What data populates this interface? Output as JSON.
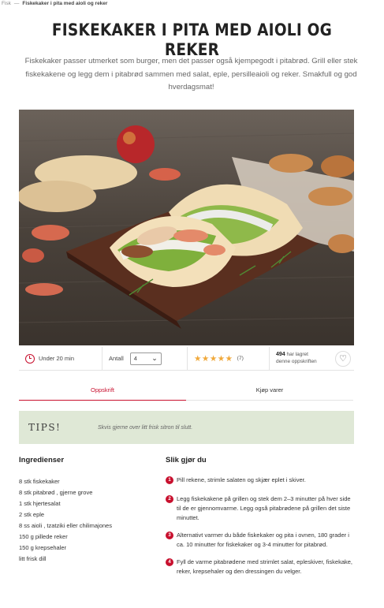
{
  "breadcrumb": {
    "parent": "Fisk",
    "separator": "—",
    "current": "Fiskekaker i pita med aioli og reker"
  },
  "title": "FISKEKAKER I PITA MED AIOLI OG REKER",
  "intro": "Fiskekaker passer utmerket som burger, men det passer også kjempegodt i pitabrød. Grill eller stek fiskekakene og legg dem i pitabrød sammen med salat, eple, persilleaioli og reker. Smakfull og god hverdagsmat!",
  "info": {
    "time": "Under 20 min",
    "antall_label": "Antall",
    "antall_value": "4",
    "stars": "★★★★★",
    "rating_count": "(7)",
    "saved_count": "494",
    "saved_text_1": " har lagret",
    "saved_text_2": "denne oppskriften"
  },
  "tabs": [
    {
      "label": "Oppskrift"
    },
    {
      "label": "Kjøp varer"
    }
  ],
  "tips": {
    "title": "TIPS!",
    "text": "Skvis gjerne over litt frisk sitron til slutt."
  },
  "ingredients": {
    "heading": "Ingredienser",
    "items": [
      "8 stk fiskekaker",
      "8 stk pitabrød , gjerne grove",
      "1 stk hjertesalat",
      "2 stk eple",
      "8 ss aioli , tzatziki eller chilimajones",
      "150 g pillede reker",
      "150 g krepsehaler",
      "litt frisk dill"
    ]
  },
  "steps": {
    "heading": "Slik gjør du",
    "items": [
      {
        "num": "1",
        "text": "Pill rekene, strimle salaten og skjær eplet i skiver."
      },
      {
        "num": "2",
        "text": "Legg fiskekakene på grillen og stek dem 2–3 minutter på hver side til de er gjennomvarme. Legg også pitabrødene på grillen det siste minuttet."
      },
      {
        "num": "3",
        "text": "Alternativt varmer du både fiskekaker og pita i ovnen, 180 grader i ca. 10 minutter for fiskekaker og 3-4 minutter for pitabrød."
      },
      {
        "num": "4",
        "text": "Fyll de varme pitabrødene med strimlet salat, epleskiver, fiskekake, reker, krepsehaler og den dressingen du velger."
      }
    ]
  },
  "colors": {
    "accent": "#c8102e",
    "tips_bg": "#dfe8d6",
    "star": "#f0a83a"
  }
}
